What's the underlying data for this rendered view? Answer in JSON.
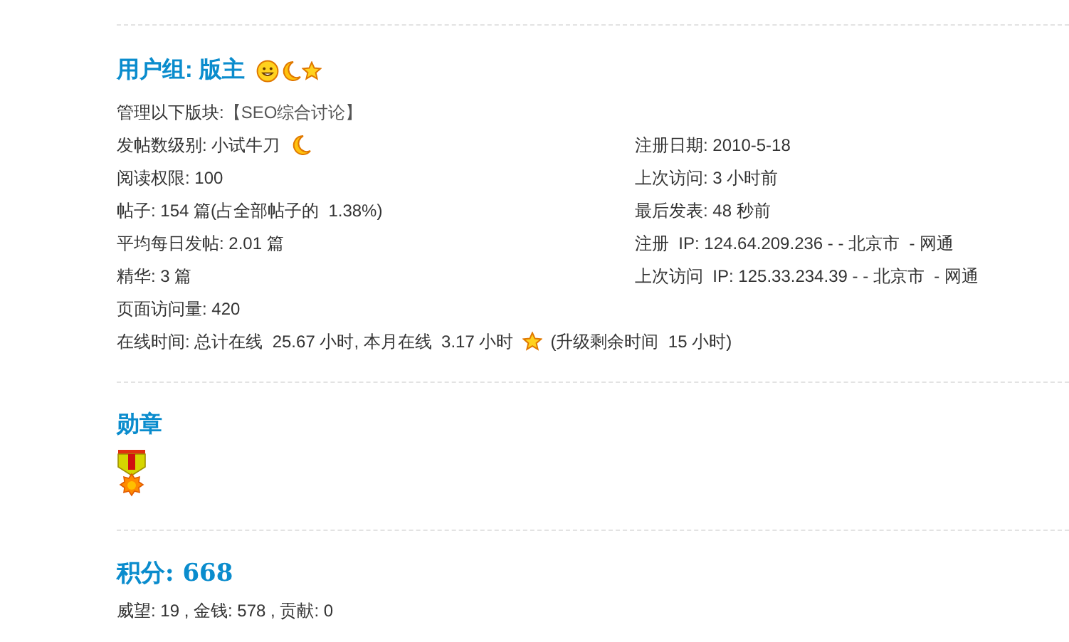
{
  "group": {
    "title": "用户组: 版主"
  },
  "managed": {
    "label": "管理以下版块:",
    "value": "【SEO综合讨论】"
  },
  "post_level": {
    "label": "发帖数级别:",
    "value": "小试牛刀"
  },
  "left_fields": [
    {
      "label": "阅读权限:",
      "value": "100"
    },
    {
      "label": "帖子:",
      "value": "154 篇(占全部帖子的  1.38%)"
    },
    {
      "label": "平均每日发帖:",
      "value": "2.01 篇"
    },
    {
      "label": "精华:",
      "value": "3 篇"
    },
    {
      "label": "页面访问量:",
      "value": "420"
    }
  ],
  "right_fields": [
    {
      "label": "注册日期:",
      "value": "2010-5-18"
    },
    {
      "label": "上次访问:",
      "value": "3 小时前"
    },
    {
      "label": "最后发表:",
      "value": "48 秒前"
    },
    {
      "label": "注册  IP:",
      "value": "124.64.209.236 - - 北京市  - 网通"
    },
    {
      "label": "上次访问  IP:",
      "value": "125.33.234.39 - - 北京市  - 网通"
    }
  ],
  "online": {
    "label": "在线时间:",
    "value": "总计在线  25.67 小时, 本月在线  3.17 小时",
    "upgrade": "(升级剩余时间  15 小时)"
  },
  "medals": {
    "title": "勋章"
  },
  "credits": {
    "title": "积分: 668",
    "details": "威望: 19 , 金钱: 578 , 贡献: 0"
  }
}
